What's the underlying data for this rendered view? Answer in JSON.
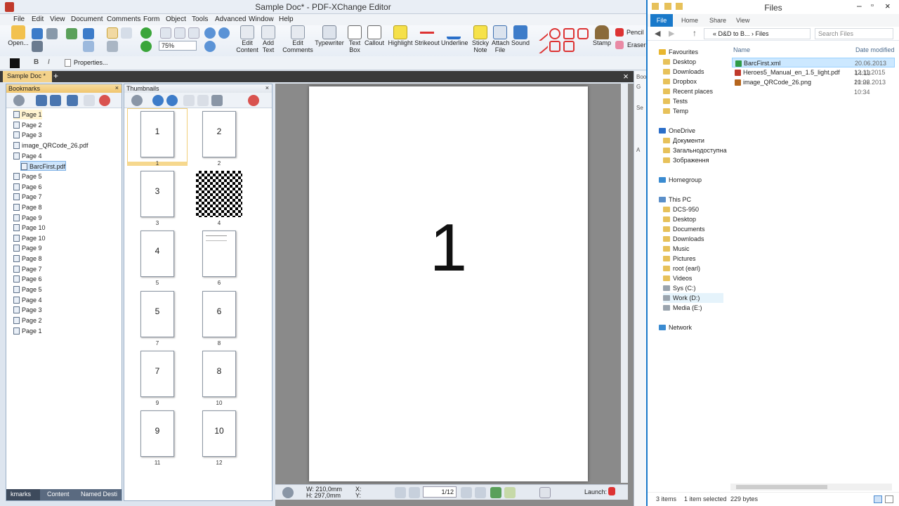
{
  "pdf": {
    "title": "Sample Doc* - PDF-XChange Editor",
    "menu": [
      "File",
      "Edit",
      "View",
      "Document",
      "Comments",
      "Form",
      "Object",
      "Tools",
      "Advanced",
      "Window",
      "Help"
    ],
    "ribbon": {
      "open": "Open...",
      "zoom": "75%",
      "edit_content": "Edit Content",
      "add_text": "Add Text",
      "edit_comments": "Edit Comments",
      "typewriter": "Typewriter",
      "text_box": "Text Box",
      "callout": "Callout",
      "highlight": "Highlight",
      "strikeout": "Strikeout",
      "underline": "Underline",
      "sticky_note": "Sticky Note",
      "attach_file": "Attach File",
      "sound": "Sound",
      "stamp": "Stamp",
      "pencil": "Pencil",
      "eraser": "Eraser",
      "properties": "Properties...",
      "bold": "B",
      "italic": "I"
    },
    "doc_tab": "Sample Doc *",
    "right_strip": [
      "Boo",
      "G",
      "Se",
      "A"
    ],
    "bookmarks": {
      "header": "Bookmarks",
      "items": [
        "Page 1",
        "Page 2",
        "Page 3",
        "image_QRCode_26.pdf",
        "Page 4",
        "BarcFirst.pdf",
        "Page 5",
        "Page 6",
        "Page 7",
        "Page 8",
        "Page 9",
        "Page 10",
        "Page 10",
        "Page 9",
        "Page 8",
        "Page 7",
        "Page 6",
        "Page 5",
        "Page 4",
        "Page 3",
        "Page 2",
        "Page 1"
      ],
      "tabs": [
        "kmarks",
        "Content",
        "Named Desti"
      ]
    },
    "thumbnails": {
      "header": "Thumbnails",
      "pages": [
        {
          "label": "1",
          "num": "1"
        },
        {
          "label": "2",
          "num": "2"
        },
        {
          "label": "3",
          "num": "3"
        },
        {
          "label": "",
          "num": "4"
        },
        {
          "label": "4",
          "num": "5"
        },
        {
          "label": "",
          "num": "6"
        },
        {
          "label": "5",
          "num": "7"
        },
        {
          "label": "6",
          "num": "8"
        },
        {
          "label": "7",
          "num": "9"
        },
        {
          "label": "8",
          "num": "10"
        },
        {
          "label": "9",
          "num": "11"
        },
        {
          "label": "10",
          "num": "12"
        }
      ]
    },
    "page_content": "1",
    "status": {
      "w": "W: 210,0mm",
      "h": "H: 297,0mm",
      "x": "X:",
      "y": "Y:",
      "page": "1/12",
      "launch": "Launch:"
    }
  },
  "explorer": {
    "title": "Files",
    "tabs": [
      "File",
      "Home",
      "Share",
      "View"
    ],
    "address": "« D&D to B... › Files",
    "search_placeholder": "Search Files",
    "nav": {
      "favourites": "Favourites",
      "fav_items": [
        "Desktop",
        "Downloads",
        "Dropbox",
        "Recent places",
        "Tests",
        "Temp"
      ],
      "onedrive": "OneDrive",
      "od_items": [
        "Документи",
        "Загальнодоступна",
        "Зображення"
      ],
      "homegroup": "Homegroup",
      "thispc": "This PC",
      "pc_items": [
        "DCS-950",
        "Desktop",
        "Documents",
        "Downloads",
        "Music",
        "Pictures",
        "root (earl)",
        "Videos",
        "Sys (C:)",
        "Work (D:)",
        "Media (E:)"
      ],
      "network": "Network"
    },
    "columns": {
      "name": "Name",
      "date": "Date modified"
    },
    "files": [
      {
        "name": "BarcFirst.xml",
        "date": "20.06.2013 14:13",
        "color": "#2f9b47"
      },
      {
        "name": "Heroes5_Manual_en_1.5_light.pdf",
        "date": "12.11.2015 10:22",
        "color": "#c0392b"
      },
      {
        "name": "image_QRCode_26.png",
        "date": "21.06.2013 10:34",
        "color": "#b5651d"
      }
    ],
    "status": {
      "items": "3 items",
      "selected": "1 item selected",
      "size": "229 bytes"
    }
  }
}
